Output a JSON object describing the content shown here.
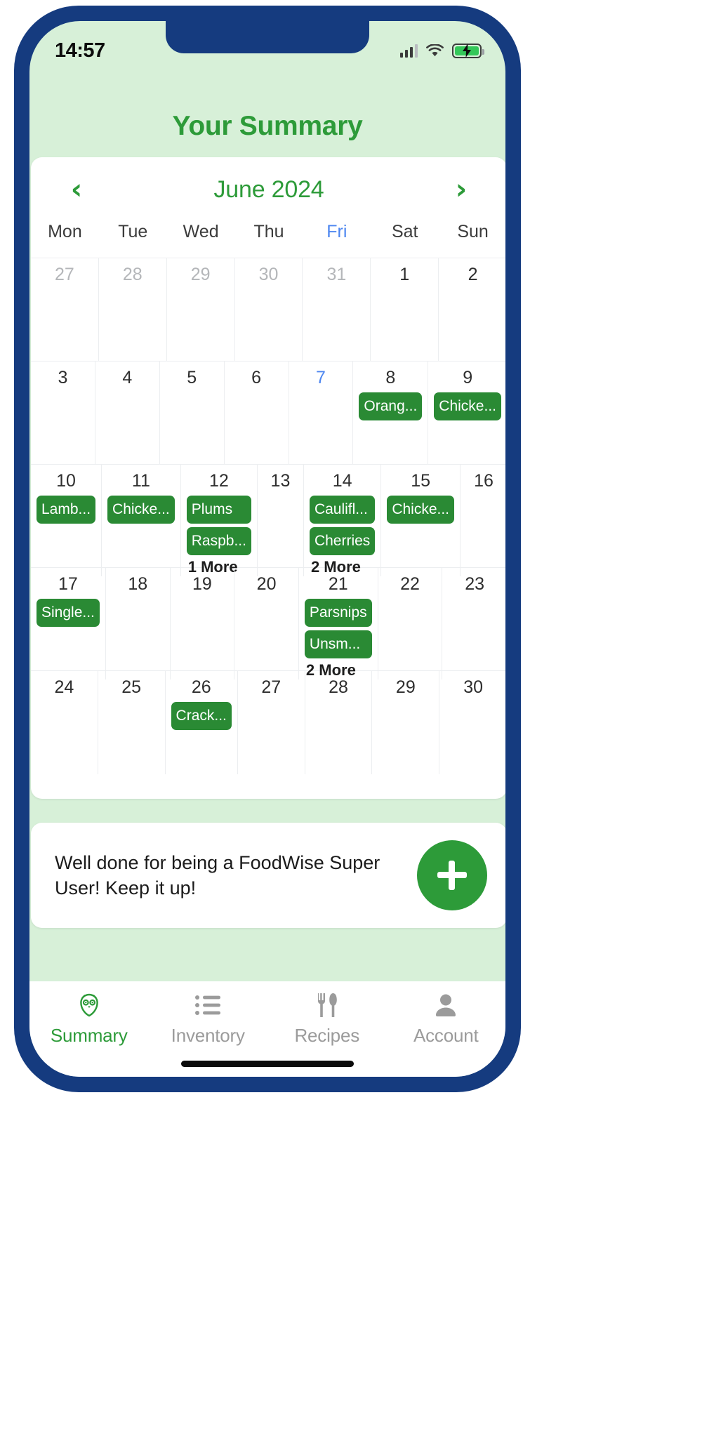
{
  "theme": {
    "bezel": "#153b7f",
    "app_bg": "#d7f0d8",
    "brand_green": "#2d9b39",
    "chip_green": "#2a8a34",
    "today_blue": "#4d86f0",
    "card_white": "#ffffff"
  },
  "status_bar": {
    "time": "14:57",
    "signal_icon": "cellular-signal-icon",
    "wifi_icon": "wifi-icon",
    "battery_icon": "battery-charging-icon"
  },
  "header": {
    "title": "Your Summary"
  },
  "calendar": {
    "prev_icon": "chevron-left-icon",
    "next_icon": "chevron-right-icon",
    "month_label": "June 2024",
    "weekdays": [
      {
        "label": "Mon",
        "today": false
      },
      {
        "label": "Tue",
        "today": false
      },
      {
        "label": "Wed",
        "today": false
      },
      {
        "label": "Thu",
        "today": false
      },
      {
        "label": "Fri",
        "today": true
      },
      {
        "label": "Sat",
        "today": false
      },
      {
        "label": "Sun",
        "today": false
      }
    ],
    "weeks": [
      [
        {
          "day": "27",
          "muted": true,
          "today": false,
          "events": [],
          "more": ""
        },
        {
          "day": "28",
          "muted": true,
          "today": false,
          "events": [],
          "more": ""
        },
        {
          "day": "29",
          "muted": true,
          "today": false,
          "events": [],
          "more": ""
        },
        {
          "day": "30",
          "muted": true,
          "today": false,
          "events": [],
          "more": ""
        },
        {
          "day": "31",
          "muted": true,
          "today": false,
          "events": [],
          "more": ""
        },
        {
          "day": "1",
          "muted": false,
          "today": false,
          "events": [],
          "more": ""
        },
        {
          "day": "2",
          "muted": false,
          "today": false,
          "events": [],
          "more": ""
        }
      ],
      [
        {
          "day": "3",
          "muted": false,
          "today": false,
          "events": [],
          "more": ""
        },
        {
          "day": "4",
          "muted": false,
          "today": false,
          "events": [],
          "more": ""
        },
        {
          "day": "5",
          "muted": false,
          "today": false,
          "events": [],
          "more": ""
        },
        {
          "day": "6",
          "muted": false,
          "today": false,
          "events": [],
          "more": ""
        },
        {
          "day": "7",
          "muted": false,
          "today": true,
          "events": [],
          "more": ""
        },
        {
          "day": "8",
          "muted": false,
          "today": false,
          "events": [
            "Orang..."
          ],
          "more": ""
        },
        {
          "day": "9",
          "muted": false,
          "today": false,
          "events": [
            "Chicke..."
          ],
          "more": ""
        }
      ],
      [
        {
          "day": "10",
          "muted": false,
          "today": false,
          "events": [
            "Lamb..."
          ],
          "more": ""
        },
        {
          "day": "11",
          "muted": false,
          "today": false,
          "events": [
            "Chicke..."
          ],
          "more": ""
        },
        {
          "day": "12",
          "muted": false,
          "today": false,
          "events": [
            "Plums",
            "Raspb..."
          ],
          "more": "1 More"
        },
        {
          "day": "13",
          "muted": false,
          "today": false,
          "events": [],
          "more": ""
        },
        {
          "day": "14",
          "muted": false,
          "today": false,
          "events": [
            "Caulifl...",
            "Cherries"
          ],
          "more": "2 More"
        },
        {
          "day": "15",
          "muted": false,
          "today": false,
          "events": [
            "Chicke..."
          ],
          "more": ""
        },
        {
          "day": "16",
          "muted": false,
          "today": false,
          "events": [],
          "more": ""
        }
      ],
      [
        {
          "day": "17",
          "muted": false,
          "today": false,
          "events": [
            "Single..."
          ],
          "more": ""
        },
        {
          "day": "18",
          "muted": false,
          "today": false,
          "events": [],
          "more": ""
        },
        {
          "day": "19",
          "muted": false,
          "today": false,
          "events": [],
          "more": ""
        },
        {
          "day": "20",
          "muted": false,
          "today": false,
          "events": [],
          "more": ""
        },
        {
          "day": "21",
          "muted": false,
          "today": false,
          "events": [
            "Parsnips",
            "Unsm..."
          ],
          "more": "2 More"
        },
        {
          "day": "22",
          "muted": false,
          "today": false,
          "events": [],
          "more": ""
        },
        {
          "day": "23",
          "muted": false,
          "today": false,
          "events": [],
          "more": ""
        }
      ],
      [
        {
          "day": "24",
          "muted": false,
          "today": false,
          "events": [],
          "more": ""
        },
        {
          "day": "25",
          "muted": false,
          "today": false,
          "events": [],
          "more": ""
        },
        {
          "day": "26",
          "muted": false,
          "today": false,
          "events": [
            "Crack..."
          ],
          "more": ""
        },
        {
          "day": "27",
          "muted": false,
          "today": false,
          "events": [],
          "more": ""
        },
        {
          "day": "28",
          "muted": false,
          "today": false,
          "events": [],
          "more": ""
        },
        {
          "day": "29",
          "muted": false,
          "today": false,
          "events": [],
          "more": ""
        },
        {
          "day": "30",
          "muted": false,
          "today": false,
          "events": [],
          "more": ""
        }
      ]
    ]
  },
  "message_card": {
    "text": "Well done for being a FoodWise Super User! Keep it up!",
    "add_button_icon": "plus-icon"
  },
  "tabbar": {
    "items": [
      {
        "label": "Summary",
        "icon": "owl-icon",
        "active": true
      },
      {
        "label": "Inventory",
        "icon": "list-icon",
        "active": false
      },
      {
        "label": "Recipes",
        "icon": "cutlery-icon",
        "active": false
      },
      {
        "label": "Account",
        "icon": "person-icon",
        "active": false
      }
    ]
  }
}
